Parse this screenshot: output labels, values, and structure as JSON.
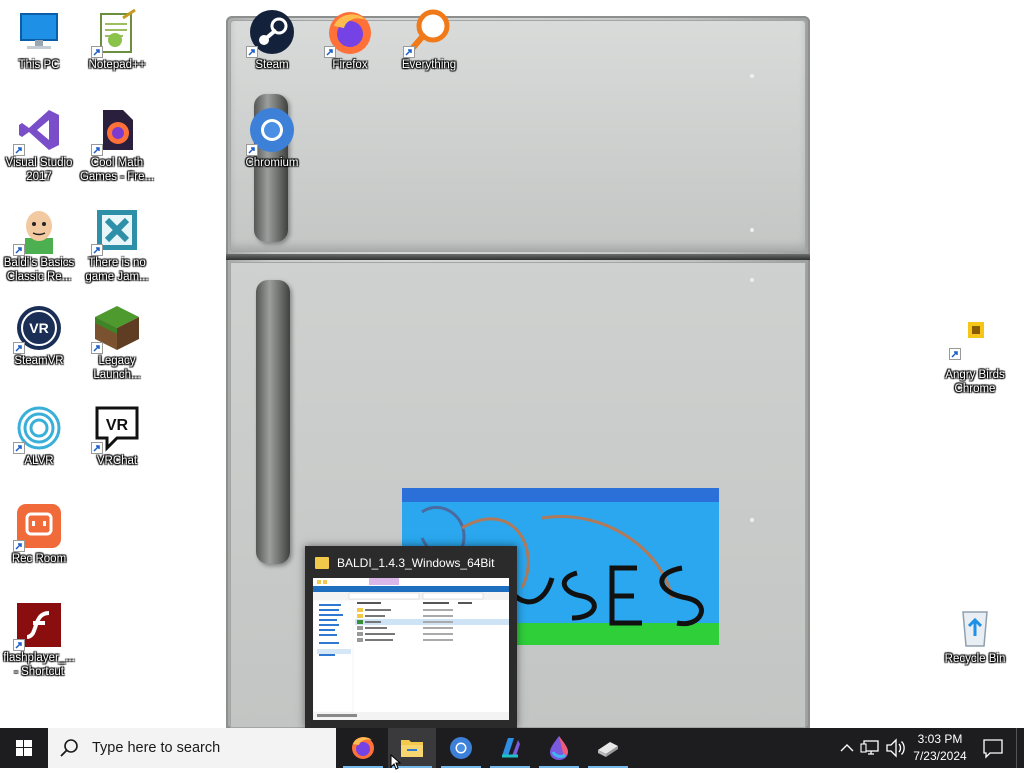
{
  "desktop": {
    "icons": {
      "this_pc": "This PC",
      "notepad": "Notepad++",
      "steam": "Steam",
      "firefox": "Firefox",
      "everything": "Everything",
      "chromium": "Chromium",
      "visual_studio": "Visual Studio 2017",
      "cool_math": "Cool Math Games - Fre...",
      "baldi": "Baldi's Basics Classic Re...",
      "no_game": "There is no game Jam...",
      "steamvr": "SteamVR",
      "legacy": "Legacy Launch...",
      "alvr": "ALVR",
      "vrchat": "VRChat",
      "rec_room": "Rec Room",
      "flashplayer": "flashplayer_... - Shortcut",
      "angry_birds": "Angry Birds Chrome",
      "recycle_bin": "Recycle Bin"
    }
  },
  "preview": {
    "title": "BALDI_1.4.3_Windows_64Bit"
  },
  "taskbar": {
    "search_placeholder": "Type here to search",
    "time": "3:03 PM",
    "date": "7/23/2024",
    "apps": [
      "firefox-icon",
      "file-explorer-icon",
      "chromium-icon",
      "copilot-icon",
      "paint-drop-icon",
      "eraser-app-icon"
    ]
  },
  "colors": {
    "taskbar_bg": "#1d1d1f",
    "accent": "#76b9ed"
  }
}
